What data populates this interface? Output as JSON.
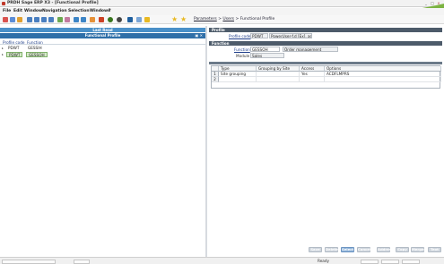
{
  "window": {
    "title": "PRDH Sage ERP X3 - [Functional Profile]"
  },
  "menu": {
    "items": [
      "File",
      "Edit",
      "Window",
      "Navigation",
      "Selection",
      "Windows",
      "?"
    ]
  },
  "breadcrumb": {
    "items": [
      "Parameters",
      "Users",
      "Functional Profile"
    ],
    "separator": ">"
  },
  "left_panel": {
    "header_top": "Last Read",
    "header_title": "Functional Profile",
    "columns": [
      "Profile code",
      "Function"
    ],
    "rows": [
      {
        "code": "PDWT",
        "function": "GESSIH"
      },
      {
        "code": "PDWT",
        "function": "GESSOH"
      }
    ]
  },
  "profile_section": {
    "title": "Profile",
    "profile_code_label": "Profile code",
    "profile_code_value": "PDWT",
    "profile_desc_value": "PowerUser-f.d [Ex]. ad/dev/ver"
  },
  "function_section": {
    "title": "Function",
    "function_label": "Function",
    "function_value": "GESSOH",
    "function_desc": "Order management",
    "module_label": "Module",
    "module_value": "Sales"
  },
  "grid": {
    "columns": [
      "Type",
      "Grouping by Site",
      "Access",
      "Options"
    ],
    "rows": [
      {
        "num": "1",
        "type": "Site grouping",
        "grouping": "",
        "access": "Yes",
        "options": "ACDFLMPRS"
      },
      {
        "num": "2",
        "type": "",
        "grouping": "",
        "access": "",
        "options": ""
      }
    ]
  },
  "buttons": [
    "Save",
    "Delete",
    "Select",
    "Cancel",
    "Address",
    "Copy",
    "Merged",
    "Text"
  ],
  "status": {
    "text": "Ready"
  },
  "colors": {
    "header_blue": "#4a90c8",
    "header_dark": "#2f6fa8",
    "section_bar": "#4d5b6a",
    "active_button": "#8fb3d9"
  }
}
